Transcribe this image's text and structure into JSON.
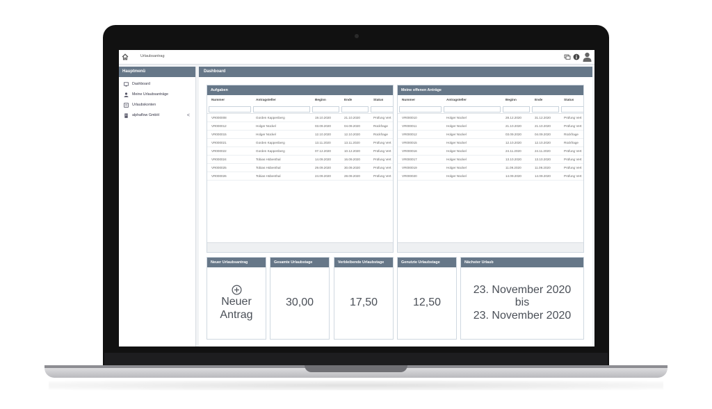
{
  "topbar": {
    "breadcrumb": "Urlaubsantrag",
    "icons": [
      "home-icon",
      "messages-icon",
      "info-icon",
      "user-avatar-icon"
    ]
  },
  "sidebar": {
    "title": "Hauptmenü",
    "items": [
      {
        "label": "Dashboard",
        "icon": "dashboard-icon"
      },
      {
        "label": "Meine Urlaubsanträge",
        "icon": "person-icon"
      },
      {
        "label": "Urlaubskonten",
        "icon": "accounts-icon"
      },
      {
        "label": "alphaflow GmbH",
        "icon": "building-icon",
        "chevron": "<"
      }
    ]
  },
  "main": {
    "title": "Dashboard"
  },
  "tasks": {
    "title": "Aufgaben",
    "columns": [
      "Nummer",
      "Antragsteller",
      "Beginn",
      "Ende",
      "Status"
    ],
    "rows": [
      [
        "VR000008",
        "Gorden Kappenberg",
        "19.10.2020",
        "21.10.2020",
        "Prüfung Vert"
      ],
      [
        "VR000012",
        "Holger Nückel",
        "03.09.2020",
        "04.09.2020",
        "Rückfrage"
      ],
      [
        "VR000015",
        "Holger Nückel",
        "12.10.2020",
        "12.10.2020",
        "Rückfrage"
      ],
      [
        "VR000021",
        "Gorden Kappenberg",
        "13.11.2020",
        "13.11.2020",
        "Prüfung Vert"
      ],
      [
        "VR000022",
        "Gorden Kappenberg",
        "07.12.2020",
        "10.12.2020",
        "Prüfung Vert"
      ],
      [
        "VR000024",
        "Tobias Hübenthal",
        "14.09.2020",
        "16.09.2020",
        "Prüfung Vert"
      ],
      [
        "VR000025",
        "Tobias Hübenthal",
        "29.09.2020",
        "30.09.2020",
        "Prüfung Vert"
      ],
      [
        "VR000026",
        "Tobias Hübenthal",
        "24.09.2020",
        "28.09.2020",
        "Prüfung Vert"
      ]
    ]
  },
  "requests": {
    "title": "Meine offenen Anträge",
    "columns": [
      "Nummer",
      "Antragsteller",
      "Beginn",
      "Ende",
      "Status"
    ],
    "rows": [
      [
        "VR000010",
        "Holger Nückel",
        "28.12.2020",
        "31.12.2020",
        "Prüfung Vert"
      ],
      [
        "VR000011",
        "Holger Nückel",
        "21.10.2020",
        "21.10.2020",
        "Prüfung Vert"
      ],
      [
        "VR000012",
        "Holger Nückel",
        "03.09.2020",
        "04.09.2020",
        "Rückfrage"
      ],
      [
        "VR000015",
        "Holger Nückel",
        "12.10.2020",
        "12.10.2020",
        "Rückfrage"
      ],
      [
        "VR000016",
        "Holger Nückel",
        "24.11.2020",
        "24.11.2020",
        "Prüfung Vert"
      ],
      [
        "VR000017",
        "Holger Nückel",
        "13.10.2020",
        "13.10.2020",
        "Prüfung Vert"
      ],
      [
        "VR000019",
        "Holger Nückel",
        "11.09.2020",
        "11.09.2020",
        "Prüfung Vert"
      ],
      [
        "VR000020",
        "Holger Nückel",
        "14.09.2020",
        "14.09.2020",
        "Prüfung Vert"
      ]
    ]
  },
  "kpis": {
    "new_request": {
      "title": "Neuer Urlaubsantrag",
      "line1": "Neuer",
      "line2": "Antrag",
      "icon": "plus-circle-icon"
    },
    "total_days": {
      "title": "Gesamte Urlaubstage",
      "value": "30,00"
    },
    "remaining_days": {
      "title": "Verbleibende Urlaubstage",
      "value": "17,50"
    },
    "used_days": {
      "title": "Genutzte Urlaubstage",
      "value": "12,50"
    },
    "next_vacation": {
      "title": "Nächster Urlaub",
      "from": "23. November 2020",
      "sep": "bis",
      "to": "23. November 2020"
    }
  }
}
